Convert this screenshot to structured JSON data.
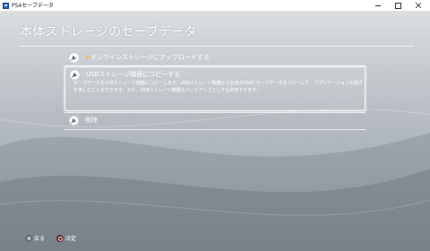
{
  "window": {
    "title": "PS4セーブデータ"
  },
  "screen": {
    "title": "本体ストレージのセーブデータ",
    "menu": [
      {
        "icon": "wrench-icon",
        "badge_icon": "plus-icon",
        "label": "オンラインストレージにアップロードする"
      },
      {
        "icon": "wrench-icon",
        "label": "USBストレージ機器にコピーする",
        "description": "セーブデータをUSBストレージ機器にコピーします。USBストレージ機器から友達のPS4にセーブデータをコピーして、アプリケーションの続きを楽しむことができます。また、USBストレージ機器をバックアップとしても利用できます。",
        "selected": true
      },
      {
        "icon": "wrench-icon",
        "label": "削除"
      }
    ]
  },
  "footer": {
    "back": {
      "icon": "cross-button-icon",
      "label": "戻る"
    },
    "enter": {
      "icon": "circle-button-icon",
      "label": "決定"
    }
  },
  "colors": {
    "selection_border": "#f2f2f2",
    "background_light": "#dcdfe2",
    "background_dark": "#8e969f",
    "badge": "#f5c518"
  }
}
